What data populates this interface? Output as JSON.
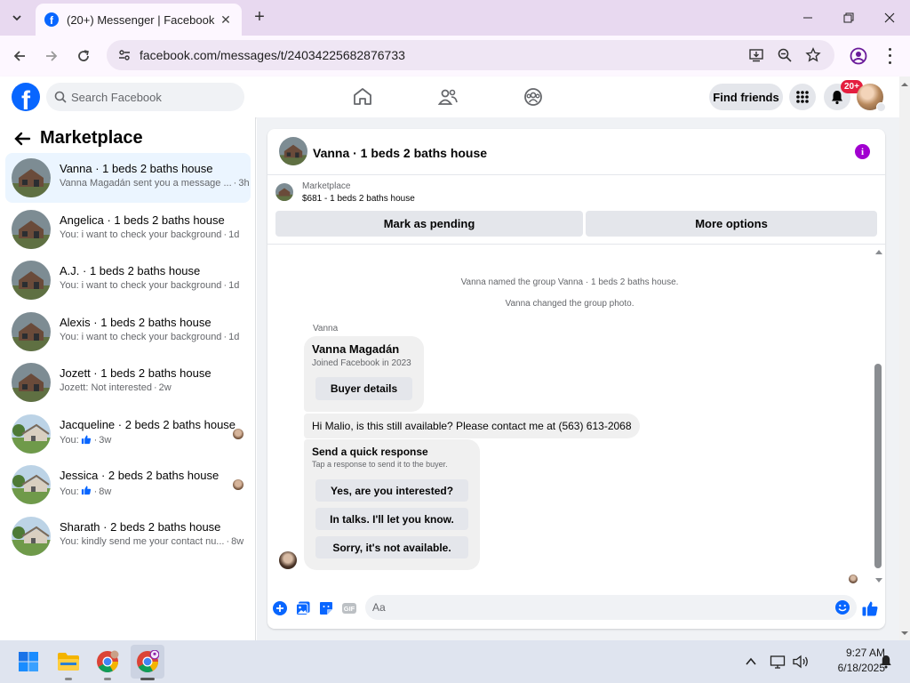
{
  "browser": {
    "tab_title": "(20+) Messenger | Facebook",
    "url": "facebook.com/messages/t/24034225682876733"
  },
  "facebook": {
    "search_placeholder": "Search Facebook",
    "find_friends": "Find friends",
    "notification_badge": "20+"
  },
  "sidebar": {
    "title": "Marketplace",
    "conversations": [
      {
        "name": "Vanna · 1 beds 2 baths house",
        "preview": "Vanna Magadán sent you a message ...",
        "time": "3h",
        "active": true,
        "like": false
      },
      {
        "name": "Angelica · 1 beds 2 baths house",
        "preview": "You: i want to check your background",
        "time": "1d",
        "active": false,
        "like": false
      },
      {
        "name": "A.J. · 1 beds 2 baths house",
        "preview": "You: i want to check your background",
        "time": "1d",
        "active": false,
        "like": false
      },
      {
        "name": "Alexis · 1 beds 2 baths house",
        "preview": "You: i want to check your background",
        "time": "1d",
        "active": false,
        "like": false
      },
      {
        "name": "Jozett · 1 beds 2 baths house",
        "preview": "Jozett: Not interested",
        "time": "2w",
        "active": false,
        "like": false
      },
      {
        "name": "Jacqueline · 2 beds 2 baths house",
        "preview": "You:",
        "time": "3w",
        "active": false,
        "like": true
      },
      {
        "name": "Jessica · 2 beds 2 baths house",
        "preview": "You:",
        "time": "8w",
        "active": false,
        "like": true
      },
      {
        "name": "Sharath · 2 beds 2 baths house",
        "preview": "You: kindly send me your contact nu...",
        "time": "8w",
        "active": false,
        "like": false
      }
    ]
  },
  "chat": {
    "title": "Vanna · 1 beds 2 baths house",
    "marketplace_label": "Marketplace",
    "listing": "$681 - 1 beds 2 baths house",
    "mark_pending": "Mark as pending",
    "more_options": "More options",
    "system_messages": [
      "Vanna named the group Vanna · 1 beds 2 baths house.",
      "Vanna changed the group photo."
    ],
    "sender": "Vanna",
    "profile_name": "Vanna Magadán",
    "profile_joined": "Joined Facebook in 2023",
    "buyer_details": "Buyer details",
    "message": "Hi Malio, is this still available? Please contact me at (563) 613-2068",
    "quick_title": "Send a quick response",
    "quick_subtitle": "Tap a response to send it to the buyer.",
    "quick_responses": [
      "Yes, are you interested?",
      "In talks. I'll let you know.",
      "Sorry, it's not available."
    ],
    "composer_placeholder": "Aa"
  },
  "taskbar": {
    "time": "9:27 AM",
    "date": "6/18/2025"
  }
}
